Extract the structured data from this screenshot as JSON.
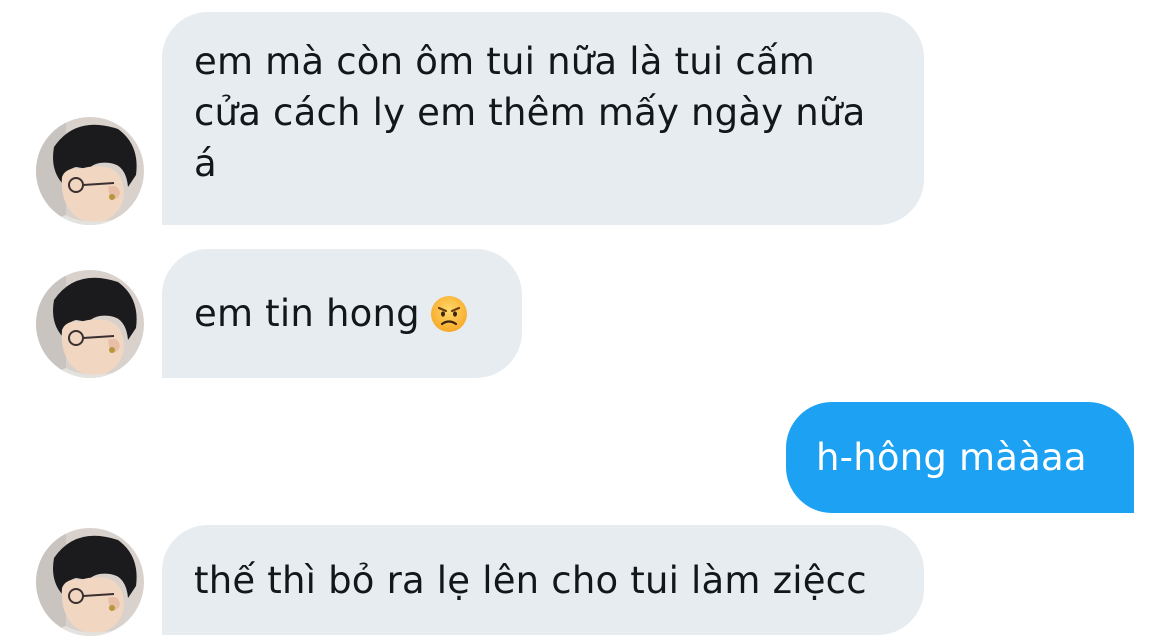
{
  "messages": [
    {
      "direction": "incoming",
      "lines": [
        "em mà còn ôm tui nữa là tui cấm",
        "cửa cách ly em thêm mấy ngày nữa",
        "á"
      ]
    },
    {
      "direction": "incoming",
      "text": "em tin hong",
      "emoji": "angry-face-icon"
    },
    {
      "direction": "outgoing",
      "text": "h-hông mààaa"
    },
    {
      "direction": "incoming",
      "text": "thế thì bỏ ra lẹ lên cho tui làm ziệcc"
    }
  ],
  "colors": {
    "incoming_bubble": "#e6ecf0",
    "outgoing_bubble": "#1da1f2",
    "incoming_text": "#14171a",
    "outgoing_text": "#ffffff"
  }
}
